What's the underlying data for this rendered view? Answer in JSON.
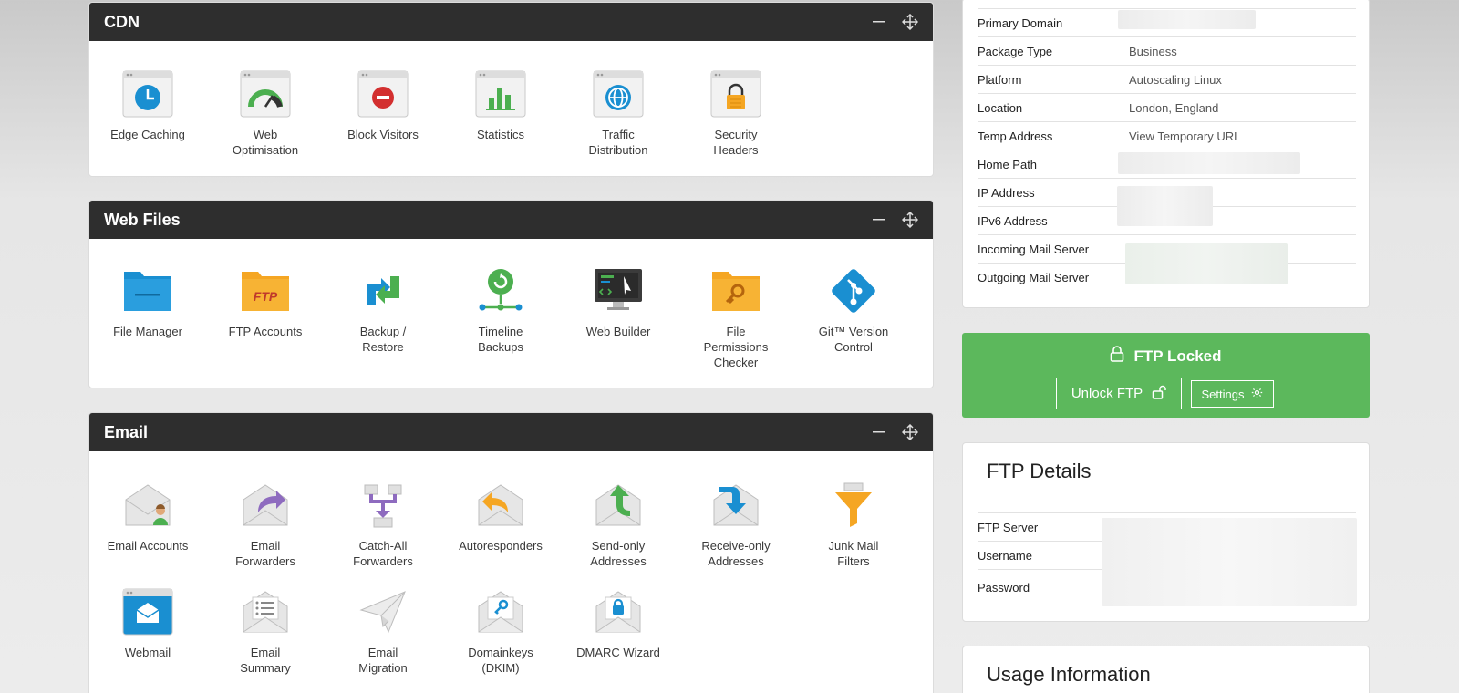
{
  "cdn": {
    "title": "CDN",
    "tiles": [
      {
        "label": "Edge Caching",
        "icon": "clock-window-icon"
      },
      {
        "label": "Web\nOptimisation",
        "icon": "gauge-window-icon"
      },
      {
        "label": "Block Visitors",
        "icon": "block-window-icon"
      },
      {
        "label": "Statistics",
        "icon": "chart-window-icon"
      },
      {
        "label": "Traffic\nDistribution",
        "icon": "globe-window-icon"
      },
      {
        "label": "Security\nHeaders",
        "icon": "lock-window-icon"
      }
    ]
  },
  "web_files": {
    "title": "Web Files",
    "tiles": [
      {
        "label": "File Manager",
        "icon": "folder-icon"
      },
      {
        "label": "FTP Accounts",
        "icon": "ftp-folder-icon"
      },
      {
        "label": "Backup /\nRestore",
        "icon": "backup-arrows-icon"
      },
      {
        "label": "Timeline\nBackups",
        "icon": "timeline-icon"
      },
      {
        "label": "Web Builder",
        "icon": "monitor-icon"
      },
      {
        "label": "File\nPermissions\nChecker",
        "icon": "key-folder-icon"
      },
      {
        "label": "Git™ Version\nControl",
        "icon": "git-icon"
      }
    ]
  },
  "email": {
    "title": "Email",
    "tiles": [
      {
        "label": "Email Accounts",
        "icon": "envelope-user-icon"
      },
      {
        "label": "Email\nForwarders",
        "icon": "envelope-forward-icon"
      },
      {
        "label": "Catch-All\nForwarders",
        "icon": "catch-all-icon"
      },
      {
        "label": "Autoresponders",
        "icon": "envelope-reply-icon"
      },
      {
        "label": "Send-only\nAddresses",
        "icon": "envelope-send-icon"
      },
      {
        "label": "Receive-only\nAddresses",
        "icon": "envelope-receive-icon"
      },
      {
        "label": "Junk Mail\nFilters",
        "icon": "funnel-icon"
      },
      {
        "label": "Webmail",
        "icon": "webmail-window-icon"
      },
      {
        "label": "Email\nSummary",
        "icon": "envelope-list-icon"
      },
      {
        "label": "Email\nMigration",
        "icon": "paper-plane-icon"
      },
      {
        "label": "Domainkeys\n(DKIM)",
        "icon": "envelope-key-icon"
      },
      {
        "label": "DMARC Wizard",
        "icon": "envelope-lock-icon"
      }
    ]
  },
  "info": {
    "rows": [
      {
        "key": "Primary Domain",
        "value": ""
      },
      {
        "key": "Package Type",
        "value": "Business"
      },
      {
        "key": "Platform",
        "value": "Autoscaling Linux"
      },
      {
        "key": "Location",
        "value": "London, England"
      },
      {
        "key": "Temp Address",
        "value": "View Temporary URL"
      },
      {
        "key": "Home Path",
        "value": ""
      },
      {
        "key": "IP Address",
        "value": ""
      },
      {
        "key": "IPv6 Address",
        "value": ""
      },
      {
        "key": "Incoming Mail Server",
        "value": ""
      },
      {
        "key": "Outgoing Mail Server",
        "value": ""
      }
    ]
  },
  "ftp_lock": {
    "title": "FTP Locked",
    "unlock_label": "Unlock FTP",
    "settings_label": "Settings"
  },
  "ftp_details": {
    "title": "FTP Details",
    "rows": [
      {
        "key": "FTP Server"
      },
      {
        "key": "Username"
      },
      {
        "key": "Password"
      }
    ]
  },
  "usage": {
    "title": "Usage Information"
  },
  "colors": {
    "header_bg": "#2e2e2e",
    "success_green": "#5cb85c",
    "icon_blue": "#1a8fd1",
    "icon_orange": "#f5a623",
    "icon_green": "#4caf50"
  }
}
